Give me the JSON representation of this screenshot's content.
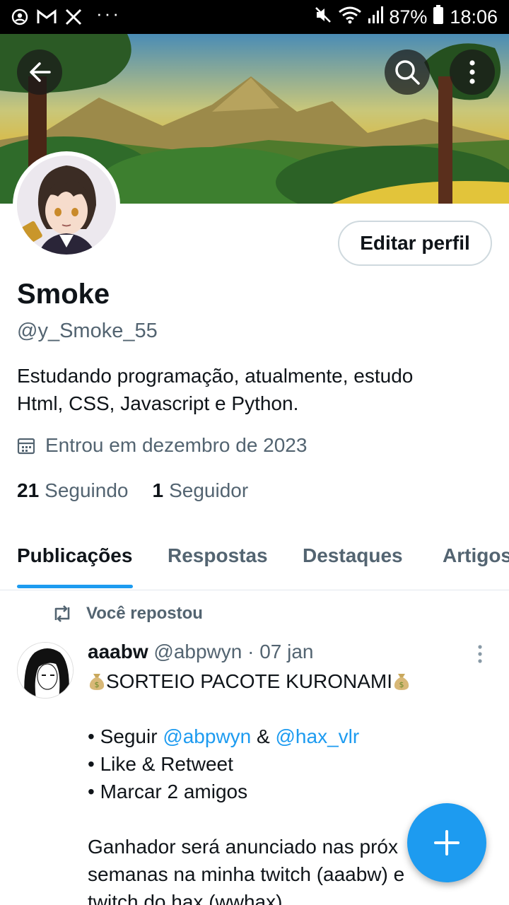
{
  "status_bar": {
    "battery": "87%",
    "time": "18:06",
    "more": "···"
  },
  "profile": {
    "name": "Smoke",
    "handle": "@y_Smoke_55",
    "edit_label": "Editar perfil",
    "bio_line1": "Estudando programação, atualmente, estudo",
    "bio_line2": "Html, CSS, Javascript e Python.",
    "joined": "Entrou em dezembro de 2023",
    "following_count": "21",
    "following_label": "Seguindo",
    "followers_count": "1",
    "followers_label": "Seguidor"
  },
  "tabs": [
    {
      "label": "Publicações",
      "active": true
    },
    {
      "label": "Respostas",
      "active": false
    },
    {
      "label": "Destaques",
      "active": false
    },
    {
      "label": "Artigos",
      "active": false
    }
  ],
  "post": {
    "repost_label": "Você repostou",
    "author_name": "aaabw",
    "author_handle": "@abpwyn",
    "separator": "·",
    "date": "07 jan",
    "title": "SORTEIO PACOTE KURONAMI",
    "bullet": "•",
    "line_follow_prefix": "Seguir",
    "mention1": "@abpwyn",
    "amp": "&",
    "mention2": "@hax_vlr",
    "line_like": "Like & Retweet",
    "line_tag": "Marcar 2 amigos",
    "line_winner1": "Ganhador será anunciado nas próx",
    "line_winner2": "semanas na minha twitch (aaabw) e",
    "line_winner3": "twitch do hax (wwhax)"
  },
  "colors": {
    "accent": "#1d9bf0",
    "text_primary": "#0f1419",
    "text_secondary": "#536471"
  }
}
